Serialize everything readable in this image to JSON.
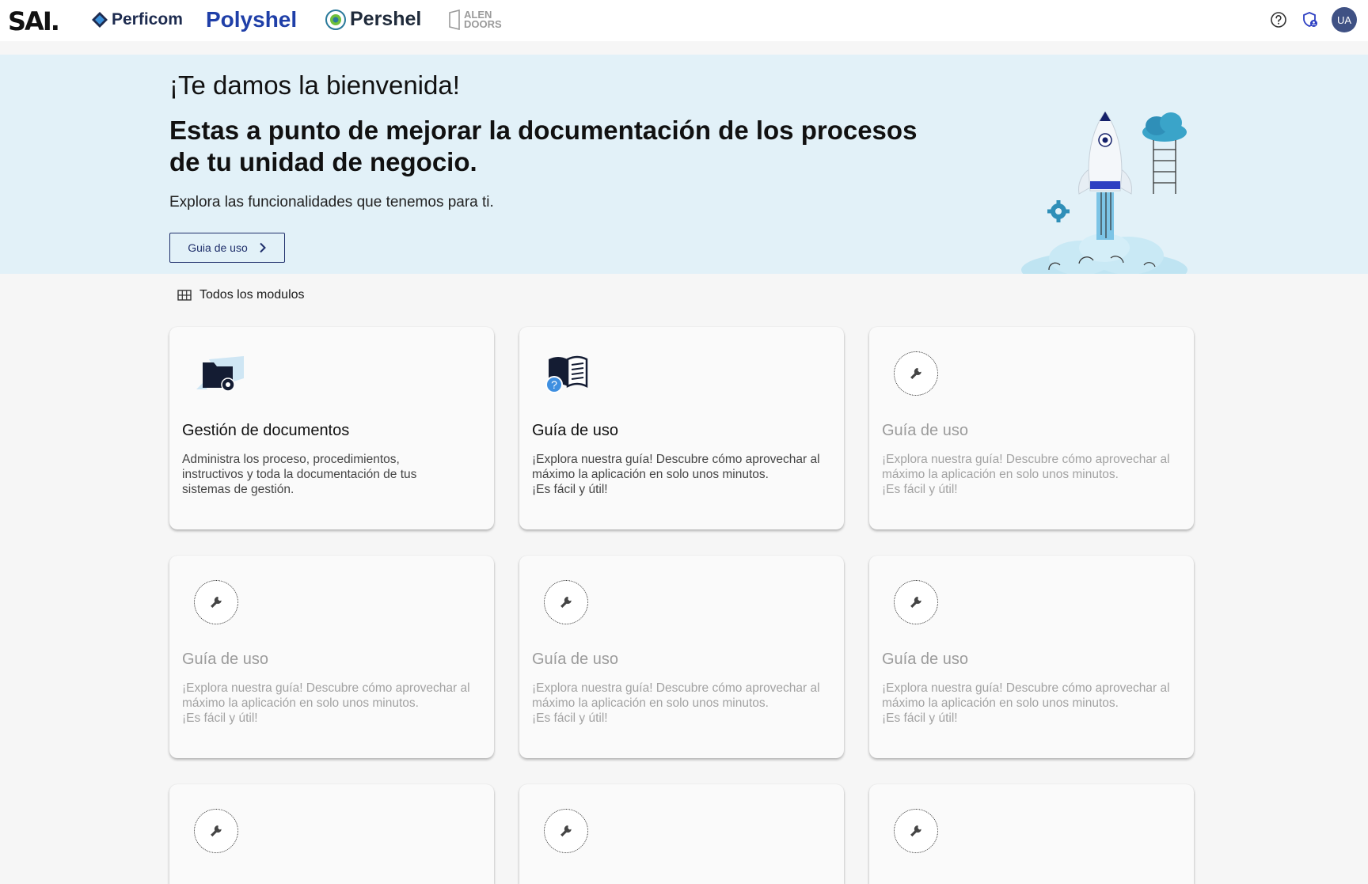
{
  "header": {
    "logo": "SAI.",
    "brands": [
      "Perficom",
      "Polyshel",
      "Pershel",
      "ALEN",
      "DOORS"
    ],
    "avatar_initials": "UA"
  },
  "hero": {
    "greeting": "¡Te damos la bienvenida!",
    "title": "Estas a punto de mejorar la documentación de los procesos de tu unidad de negocio.",
    "subtitle": "Explora las funcionalidades que tenemos para ti.",
    "button_label": "Guia de uso"
  },
  "section": {
    "label": "Todos los modulos"
  },
  "modules": [
    {
      "title": "Gestión de documentos",
      "desc_lines": [
        "Administra los proceso, procedimientos,",
        "instructivos y toda la documentación de tus",
        "sistemas de gestión."
      ]
    },
    {
      "title": "Guía de uso",
      "desc_lines": [
        "¡Explora nuestra guía! Descubre cómo aprovechar al",
        "máximo la aplicación en solo unos minutos.",
        "¡Es fácil y útil!"
      ]
    },
    {
      "title": "Guía de uso",
      "desc_lines": [
        "¡Explora nuestra guía! Descubre cómo aprovechar al",
        "máximo la aplicación en solo unos minutos.",
        "¡Es fácil y útil!"
      ]
    },
    {
      "title": "Guía de uso",
      "desc_lines": [
        "¡Explora nuestra guía! Descubre cómo aprovechar al",
        "máximo la aplicación en solo unos minutos.",
        "¡Es fácil y útil!"
      ]
    },
    {
      "title": "Guía de uso",
      "desc_lines": [
        "¡Explora nuestra guía! Descubre cómo aprovechar al",
        "máximo la aplicación en solo unos minutos.",
        "¡Es fácil y útil!"
      ]
    },
    {
      "title": "Guía de uso",
      "desc_lines": [
        "¡Explora nuestra guía! Descubre cómo aprovechar al",
        "máximo la aplicación en solo unos minutos.",
        "¡Es fácil y útil!"
      ]
    }
  ],
  "colors": {
    "hero_bg": "#e2f1f8",
    "accent": "#1f2f6b",
    "avatar_bg": "#3f5184"
  }
}
